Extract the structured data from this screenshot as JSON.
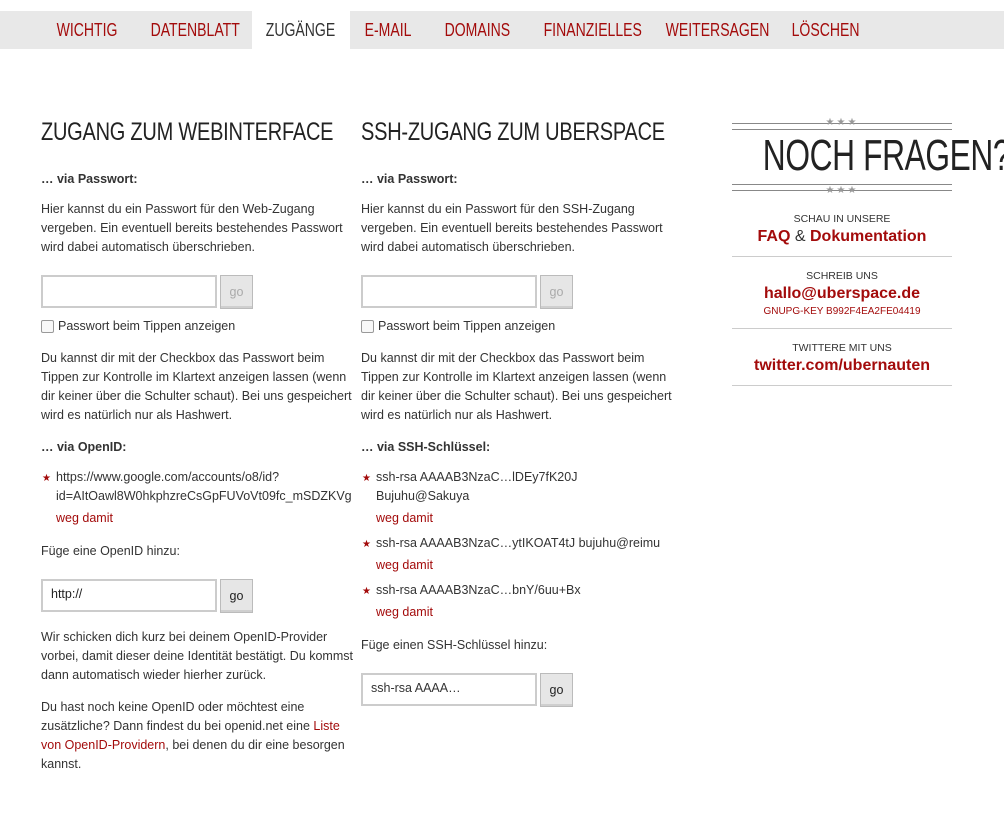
{
  "nav": {
    "tabs": [
      {
        "label": "WICHTIG",
        "active": false
      },
      {
        "label": "DATENBLATT",
        "active": false
      },
      {
        "label": "ZUGÄNGE",
        "active": true
      },
      {
        "label": "E-MAIL",
        "active": false
      },
      {
        "label": "DOMAINS",
        "active": false
      },
      {
        "label": "FINANZIELLES",
        "active": false
      },
      {
        "label": "WEITERSAGEN",
        "active": false
      },
      {
        "label": "LÖSCHEN",
        "active": false
      }
    ]
  },
  "web": {
    "title": "ZUGANG ZUM WEBINTERFACE",
    "via_password": "… via Passwort:",
    "pw_intro": [
      "Hier kannst du ein Passwort für den Web-Zugang",
      "vergeben. Ein eventuell bereits bestehendes Passwort",
      "wird dabei automatisch überschrieben."
    ],
    "pw_value": "",
    "go": "go",
    "show_pw_label": "Passwort beim Tippen anzeigen",
    "pw_note": [
      "Du kannst dir mit der Checkbox das Passwort beim",
      "Tippen zur Kontrolle im Klartext anzeigen lassen (wenn",
      "dir keiner über die Schulter schaut). Bei uns gespeichert",
      "wird es natürlich nur als Hashwert."
    ],
    "via_openid": "… via OpenID:",
    "openid_line1": "https://www.google.com/accounts/o8/id?",
    "openid_line2": "id=AItOawl8W0hkphzreCsGpFUVoVt09fc_mSDZKVg",
    "remove": "weg damit",
    "add_openid": "Füge eine OpenID hinzu:",
    "openid_input": "http://",
    "openid_note": [
      "Wir schicken dich kurz bei deinem OpenID-Provider",
      "vorbei, damit dieser deine Identität bestätigt. Du kommst",
      "dann automatisch wieder hierher zurück."
    ],
    "no_openid_1": "Du hast noch keine OpenID oder möchtest eine",
    "no_openid_2a": "zusätzliche? Dann findest du bei openid.net eine ",
    "no_openid_link_a": "Liste",
    "no_openid_link_b": "von OpenID-Providern",
    "no_openid_3b": ", bei denen du dir eine besorgen",
    "no_openid_4": "kannst."
  },
  "ssh": {
    "title": "SSH-ZUGANG ZUM UBERSPACE",
    "via_password": "… via Passwort:",
    "pw_intro": [
      "Hier kannst du ein Passwort für den SSH-Zugang",
      "vergeben. Ein eventuell bereits bestehendes Passwort",
      "wird dabei automatisch überschrieben."
    ],
    "pw_value": "",
    "go": "go",
    "show_pw_label": "Passwort beim Tippen anzeigen",
    "pw_note": [
      "Du kannst dir mit der Checkbox das Passwort beim",
      "Tippen zur Kontrolle im Klartext anzeigen lassen (wenn",
      "dir keiner über die Schulter schaut). Bei uns gespeichert",
      "wird es natürlich nur als Hashwert."
    ],
    "via_key": "… via SSH-Schlüssel:",
    "keys": [
      {
        "line1": "ssh-rsa AAAAB3NzaC…lDEy7fK20J",
        "line2": "Bujuhu@Sakuya"
      },
      {
        "line1": "ssh-rsa AAAAB3NzaC…ytIKOAT4tJ bujuhu@reimu",
        "line2": ""
      },
      {
        "line1": "ssh-rsa AAAAB3NzaC…bnY/6uu+Bx",
        "line2": ""
      }
    ],
    "remove": "weg damit",
    "add_key": "Füge einen SSH-Schlüssel hinzu:",
    "key_placeholder": "ssh-rsa AAAA…"
  },
  "sidebar": {
    "title": "NOCH FRAGEN?",
    "stars": "★★★",
    "look_label": "SCHAU IN UNSERE",
    "faq": "FAQ",
    "amp": "&",
    "docs": "Dokumentation",
    "write_label": "SCHREIB UNS",
    "email": "hallo@uberspace.de",
    "gpg": "GNUPG-KEY B992F4EA2FE04419",
    "twitter_label": "TWITTERE MIT UNS",
    "twitter": "twitter.com/ubernauten"
  }
}
